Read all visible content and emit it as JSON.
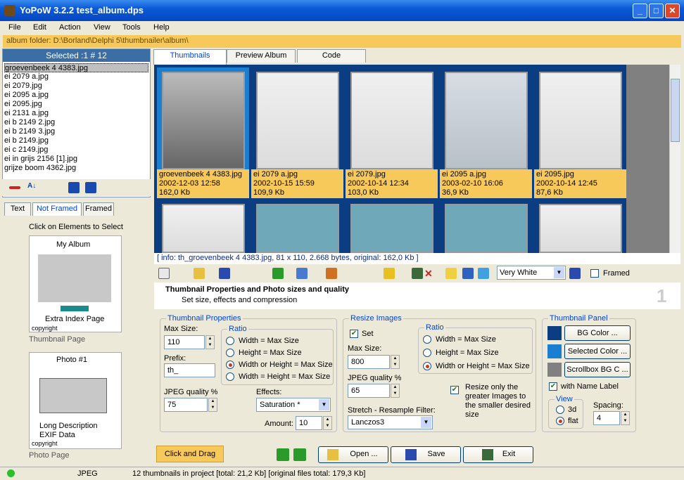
{
  "window": {
    "title": "YoPoW 3.2.2 test_album.dps"
  },
  "menu": [
    "File",
    "Edit",
    "Action",
    "View",
    "Tools",
    "Help"
  ],
  "album_folder": "album folder: D:\\Borland\\Delphi 5\\thumbnailer\\album\\",
  "left": {
    "selected": "Selected :1 # 12",
    "files": [
      "groevenbeek 4 4383.jpg",
      "ei 2079 a.jpg",
      "ei 2079.jpg",
      "ei 2095 a.jpg",
      "ei 2095.jpg",
      "ei 2131 a.jpg",
      "ei b 2149 2.jpg",
      "ei b 2149 3.jpg",
      "ei b 2149.jpg",
      "ei c 2149.jpg",
      "ei in grijs 2156 [1].jpg",
      "grijze boom 4362.jpg"
    ],
    "tabs": [
      "Text",
      "Not Framed",
      "Framed"
    ],
    "hint": "Click on Elements to Select",
    "thumb_page": {
      "album": "My Album",
      "extra": "Extra Index Page",
      "copyright": "copyright",
      "caption": "Thumbnail Page"
    },
    "photo_page": {
      "title": "Photo #1",
      "long": "Long Description",
      "exif": "EXIF Data",
      "copyright": "copyright",
      "caption": "Photo Page"
    }
  },
  "main_tabs": [
    "Thumbnails",
    "Preview Album",
    "Code"
  ],
  "thumbnails": [
    {
      "name": "groevenbeek 4 4383.jpg",
      "date": "2002-12-03 12:58",
      "size": "162,0 Kb"
    },
    {
      "name": "ei 2079 a.jpg",
      "date": "2002-10-15 15:59",
      "size": "109,9 Kb"
    },
    {
      "name": "ei 2079.jpg",
      "date": "2002-10-14 12:34",
      "size": "103,0 Kb"
    },
    {
      "name": "ei 2095 a.jpg",
      "date": "2003-02-10 16:06",
      "size": "36,9 Kb"
    },
    {
      "name": "ei 2095.jpg",
      "date": "2002-10-14 12:45",
      "size": "87,6 Kb"
    }
  ],
  "info": "[ info:  th_groevenbeek 4 4383.jpg,  81 x 110,  2.668 bytes,  original: 162,0 Kb ]",
  "toolbar": {
    "color_select": "Very White",
    "framed": "Framed"
  },
  "heading": {
    "title": "Thumbnail Properties and Photo sizes and quality",
    "subtitle": "Set size, effects and compression",
    "step": "1"
  },
  "thumb_props": {
    "title": "Thumbnail Properties",
    "max_size_label": "Max Size:",
    "max_size": "110",
    "prefix_label": "Prefix:",
    "prefix": "th_",
    "jpeg_label": "JPEG quality  %",
    "jpeg": "75",
    "ratio_title": "Ratio",
    "ratio": [
      "Width = Max Size",
      "Height = Max Size",
      "Width or Height = Max Size",
      "Width = Height = Max Size"
    ],
    "effects_label": "Effects:",
    "effects": "Saturation *",
    "amount_label": "Amount:",
    "amount": "10"
  },
  "resize": {
    "title": "Resize Images",
    "set": "Set",
    "max_size_label": "Max Size:",
    "max_size": "800",
    "jpeg_label": "JPEG quality %",
    "jpeg": "65",
    "ratio_title": "Ratio",
    "ratio": [
      "Width = Max Size",
      "Height = Max Size",
      "Width or Height = Max Size"
    ],
    "only_greater": "Resize only the greater Images to the smaller desired size",
    "stretch_label": "Stretch - Resample Filter:",
    "stretch": "Lanczos3"
  },
  "panel": {
    "title": "Thumbnail Panel",
    "bg_color": "BG Color ...",
    "selected_color": "Selected Color ...",
    "scrollbox": "Scrollbox BG C ...",
    "name_label": "with Name Label",
    "view_title": "View",
    "view_3d": "3d",
    "view_flat": "flat",
    "spacing_label": "Spacing:",
    "spacing": "4",
    "colors": {
      "bg": "#0b3d82",
      "selected": "#1a7fd0",
      "scrollbox": "#808080"
    }
  },
  "bottom": {
    "click_drag": "Click and Drag",
    "open": "Open ...",
    "save": "Save",
    "exit": "Exit"
  },
  "status": {
    "format": "JPEG",
    "text": "12 thumbnails in project [total: 21,2 Kb] [original files total: 179,3 Kb]"
  }
}
